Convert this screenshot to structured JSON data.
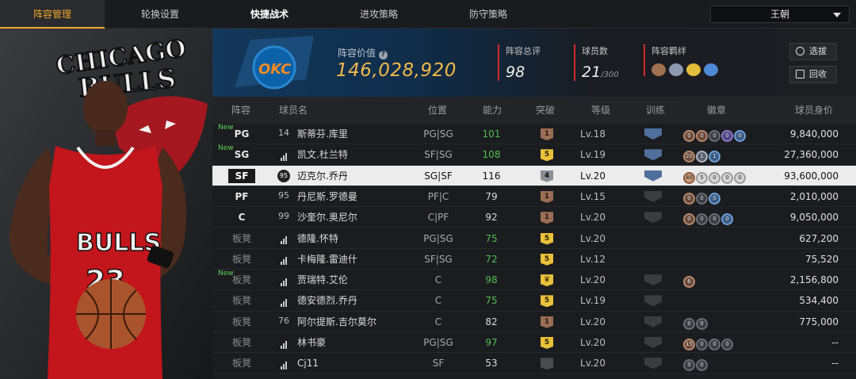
{
  "tabs": [
    "阵容管理",
    "轮换设置",
    "快捷战术",
    "进攻策略",
    "防守策略"
  ],
  "team_select": {
    "value": "王朝"
  },
  "left": {
    "banner_text_1": "CHICAGO",
    "banner_text_2": "BULLS",
    "jersey_text": "BULLS",
    "jersey_number": "23"
  },
  "header": {
    "logo_text": "OKC",
    "value_label": "阵容价值",
    "value": "146,028,920",
    "overall_label": "阵容总评",
    "overall": "98",
    "count_label": "球员数",
    "count": "21",
    "count_max": "/300",
    "bond_label": "阵容羁绊",
    "btn_draft": "选拔",
    "btn_recycle": "回收"
  },
  "columns": [
    "阵容",
    "球员名",
    "位置",
    "能力",
    "突破",
    "等级",
    "训练",
    "徽章",
    "球员身价"
  ],
  "players": [
    {
      "pos": "PG",
      "bench": false,
      "new": true,
      "num": "14",
      "name": "斯蒂芬.库里",
      "ppos": "PG|SG",
      "rating": "101",
      "green": true,
      "break": "1",
      "bclass": "b-brown",
      "lv": "Lv.18",
      "train": "sh-blue",
      "badges": [
        [
          "bronze",
          "0"
        ],
        [
          "bronze",
          "0"
        ],
        [
          "",
          "0"
        ],
        [
          "purple",
          "0"
        ],
        [
          "blue",
          "0"
        ]
      ],
      "salary": "9,840,000"
    },
    {
      "pos": "SG",
      "bench": false,
      "new": true,
      "num": "",
      "name": "凯文.杜兰特",
      "ppos": "SF|SG",
      "rating": "108",
      "green": true,
      "break": "5",
      "bclass": "b-gold",
      "lv": "Lv.19",
      "train": "sh-blue",
      "badges": [
        [
          "bronze",
          "20"
        ],
        [
          "silver",
          "1"
        ],
        [
          "blue",
          "1"
        ]
      ],
      "salary": "27,360,000"
    },
    {
      "pos": "SF",
      "bench": false,
      "new": false,
      "sel": true,
      "num": "95",
      "name": "迈克尔.乔丹",
      "ppos": "SG|SF",
      "rating": "116",
      "green": false,
      "break": "4",
      "bclass": "b-gray",
      "lv": "Lv.20",
      "train": "sh-blue",
      "badges": [
        [
          "bronze",
          "40"
        ],
        [
          "",
          "5"
        ],
        [
          "",
          "0"
        ],
        [
          "",
          "0"
        ],
        [
          "",
          "0"
        ]
      ],
      "salary": "93,600,000"
    },
    {
      "pos": "PF",
      "bench": false,
      "new": false,
      "num": "95",
      "name": "丹尼斯.罗德曼",
      "ppos": "PF|C",
      "rating": "79",
      "green": false,
      "break": "1",
      "bclass": "b-brown",
      "lv": "Lv.15",
      "train": "sh-ghost",
      "badges": [
        [
          "bronze",
          "0"
        ],
        [
          "",
          "0"
        ],
        [
          "blue",
          "0"
        ]
      ],
      "salary": "2,010,000"
    },
    {
      "pos": "C",
      "bench": false,
      "new": false,
      "num": "99",
      "name": "沙奎尔.奥尼尔",
      "ppos": "C|PF",
      "rating": "92",
      "green": false,
      "break": "1",
      "bclass": "b-brown",
      "lv": "Lv.20",
      "train": "sh-ghost",
      "badges": [
        [
          "bronze",
          "0"
        ],
        [
          "",
          "0"
        ],
        [
          "",
          "0"
        ],
        [
          "blue",
          "0"
        ]
      ],
      "salary": "9,050,000"
    },
    {
      "pos": "板凳",
      "bench": true,
      "new": false,
      "num": "",
      "name": "德隆.怀特",
      "ppos": "PG|SG",
      "rating": "75",
      "green": true,
      "break": "5",
      "bclass": "b-gold",
      "lv": "Lv.20",
      "train": "",
      "badges": [],
      "salary": "627,200"
    },
    {
      "pos": "板凳",
      "bench": true,
      "new": false,
      "num": "",
      "name": "卡梅隆.雷迪什",
      "ppos": "SF|SG",
      "rating": "72",
      "green": true,
      "break": "5",
      "bclass": "b-gold",
      "lv": "Lv.12",
      "train": "",
      "badges": [],
      "salary": "75,520"
    },
    {
      "pos": "板凳",
      "bench": true,
      "new": true,
      "num": "",
      "name": "贾瑞特.艾伦",
      "ppos": "C",
      "rating": "98",
      "green": true,
      "break": "♛",
      "bclass": "b-gold",
      "lv": "Lv.20",
      "train": "sh-ghost",
      "badges": [
        [
          "bronze",
          "6"
        ]
      ],
      "salary": "2,156,800"
    },
    {
      "pos": "板凳",
      "bench": true,
      "new": false,
      "num": "",
      "name": "德安德烈.乔丹",
      "ppos": "C",
      "rating": "75",
      "green": true,
      "break": "5",
      "bclass": "b-gold",
      "lv": "Lv.19",
      "train": "sh-ghost",
      "badges": [],
      "salary": "534,400"
    },
    {
      "pos": "板凳",
      "bench": true,
      "new": false,
      "num": "76",
      "name": "阿尔提斯.吉尔莫尔",
      "ppos": "C",
      "rating": "82",
      "green": false,
      "break": "1",
      "bclass": "b-brown",
      "lv": "Lv.20",
      "train": "sh-ghost",
      "badges": [
        [
          "",
          "0"
        ],
        [
          "",
          "0"
        ]
      ],
      "salary": "775,000"
    },
    {
      "pos": "板凳",
      "bench": true,
      "new": false,
      "num": "",
      "name": "林书豪",
      "ppos": "PG|SG",
      "rating": "97",
      "green": true,
      "break": "5",
      "bclass": "b-gold",
      "lv": "Lv.20",
      "train": "sh-ghost",
      "badges": [
        [
          "bronze",
          "15"
        ],
        [
          "",
          "0"
        ],
        [
          "",
          "0"
        ],
        [
          "",
          "0"
        ]
      ],
      "salary": "--"
    },
    {
      "pos": "板凳",
      "bench": true,
      "new": false,
      "num": "",
      "name": "Cj11",
      "ppos": "SF",
      "rating": "53",
      "green": false,
      "break": "",
      "bclass": "b-dark",
      "lv": "Lv.20",
      "train": "sh-ghost",
      "badges": [
        [
          "",
          "0"
        ],
        [
          "",
          "0"
        ]
      ],
      "salary": "--"
    }
  ],
  "new_label": "New"
}
